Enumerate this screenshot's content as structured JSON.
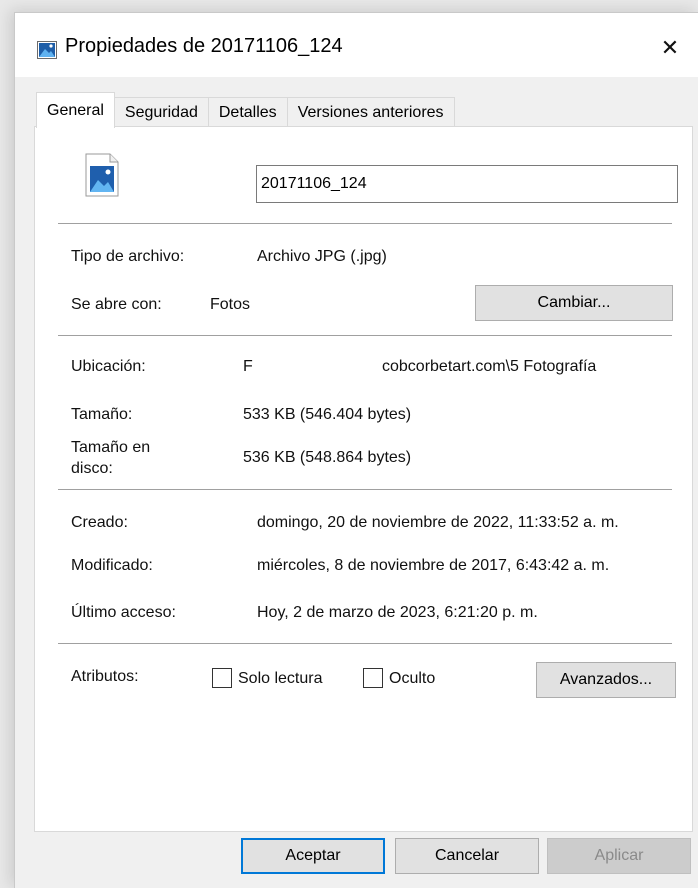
{
  "window": {
    "title": "Propiedades de 20171106_124"
  },
  "tabs": [
    {
      "label": "General"
    },
    {
      "label": "Seguridad"
    },
    {
      "label": "Detalles"
    },
    {
      "label": "Versiones anteriores"
    }
  ],
  "general": {
    "file_name_value": "20171106_124",
    "tipo_label": "Tipo de archivo:",
    "tipo_value": "Archivo JPG (.jpg)",
    "abre_label": "Se abre con:",
    "abre_value": "Fotos",
    "cambiar_button": "Cambiar...",
    "ubicacion_label": "Ubicación:",
    "ubicacion_drive": "F",
    "ubicacion_path": "cobcorbetart.com\\5 Fotografía",
    "tamano_label": "Tamaño:",
    "tamano_value": "533 KB (546.404 bytes)",
    "tamano_disco_label_1": "Tamaño en",
    "tamano_disco_label_2": "disco:",
    "tamano_disco_value": "536 KB (548.864 bytes)",
    "creado_label": "Creado:",
    "creado_value": "domingo, 20 de noviembre de 2022, 11:33:52 a. m.",
    "modificado_label": "Modificado:",
    "modificado_value": "miércoles, 8 de noviembre de 2017, 6:43:42 a. m.",
    "acceso_label": "Último acceso:",
    "acceso_value": "Hoy, 2 de marzo de 2023, 6:21:20 p. m.",
    "atributos_label": "Atributos:",
    "solo_lectura_label": "Solo lectura",
    "solo_lectura_checked": false,
    "oculto_label": "Oculto",
    "oculto_checked": false,
    "avanzados_button": "Avanzados..."
  },
  "footer": {
    "aceptar": "Aceptar",
    "cancelar": "Cancelar",
    "aplicar": "Aplicar"
  },
  "colors": {
    "accent": "#0078d7",
    "icon_blue": "#1e64b4"
  }
}
